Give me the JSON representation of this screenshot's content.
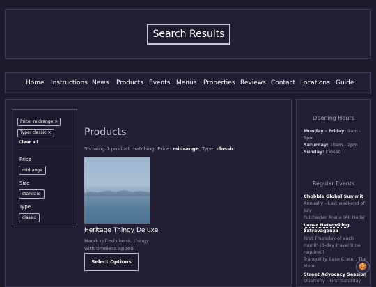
{
  "header": {
    "title": "Search Results"
  },
  "nav": {
    "items": [
      "Home",
      "Instructions",
      "News",
      "Products",
      "Events",
      "Menus",
      "Properties",
      "Reviews",
      "Contact",
      "Locations",
      "Guide"
    ]
  },
  "filters": {
    "active": [
      "Price: midrange",
      "Type: classic"
    ],
    "remove_glyph": "×",
    "clear_all": "Clear all",
    "groups": [
      {
        "label": "Price",
        "option": "midrange"
      },
      {
        "label": "Size",
        "option": "standard"
      },
      {
        "label": "Type",
        "option": "classic"
      }
    ]
  },
  "main": {
    "title": "Products",
    "showing_prefix": "Showing 1 product matching: Price: ",
    "showing_price": "midrange",
    "showing_mid": ", Type: ",
    "showing_type": "classic"
  },
  "product": {
    "name": "Heritage Thingy Deluxe",
    "description": "Handcrafted classic thingy with timeless appeal",
    "button": "Select Options"
  },
  "aside": {
    "hours_title": "Opening Hours",
    "hours": [
      {
        "day": "Monday - Friday:",
        "time": "9am - 5pm"
      },
      {
        "day": "Saturday:",
        "time": "10am - 2pm"
      },
      {
        "day": "Sunday:",
        "time": "Closed"
      }
    ],
    "events_title": "Regular Events",
    "events": [
      {
        "title": "Chobble Global Summit",
        "info": "Annually - Last weekend of July",
        "location": "Fulchester Arena (All Halls)"
      },
      {
        "title": "Lunar Networking Extravaganza",
        "info": "First Thursday of each month (3-day travel time required)",
        "location": "Tranquility Base Crater, The Moon"
      },
      {
        "title": "Street Advocacy Session",
        "info": "Quarterly - First Saturday"
      }
    ]
  },
  "cookie": {
    "icon": "cookie-icon",
    "glyph": "🍪"
  }
}
